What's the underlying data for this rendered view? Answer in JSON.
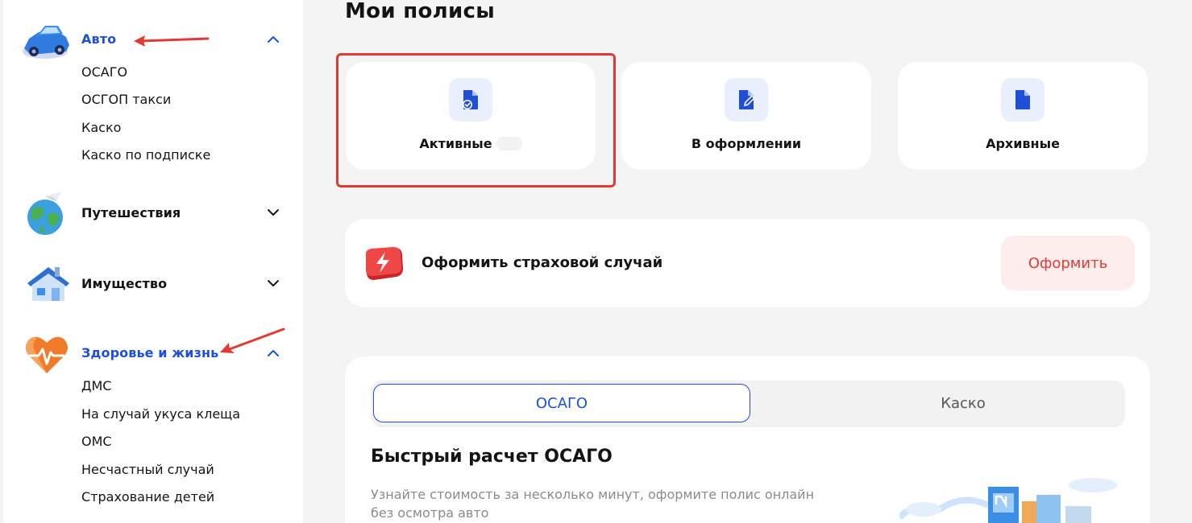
{
  "sidebar": {
    "auto": {
      "label": "Авто",
      "items": [
        "ОСАГО",
        "ОСГОП такси",
        "Каско",
        "Каско по подписке"
      ]
    },
    "travel": {
      "label": "Путешествия"
    },
    "property": {
      "label": "Имущество"
    },
    "health": {
      "label": "Здоровье и жизнь",
      "items": [
        "ДМС",
        "На случай укуса клеща",
        "ОМС",
        "Несчастный случай",
        "Страхование детей"
      ]
    }
  },
  "main": {
    "title": "Мои полисы",
    "cards": [
      {
        "label": "Активные",
        "icon": "document-check-icon"
      },
      {
        "label": "В оформлении",
        "icon": "document-edit-icon"
      },
      {
        "label": "Архивные",
        "icon": "document-icon"
      }
    ],
    "claim": {
      "text": "Оформить страховой случай",
      "button": "Оформить"
    },
    "calc": {
      "tabs": [
        "ОСАГО",
        "Каско"
      ],
      "title": "Быстрый расчет ОСАГО",
      "description": "Узнайте стоимость за несколько минут, оформите полис онлайн без осмотра авто"
    }
  },
  "colors": {
    "accent": "#1f4fd6",
    "danger": "#e53935",
    "annotation": "#e13a35"
  }
}
